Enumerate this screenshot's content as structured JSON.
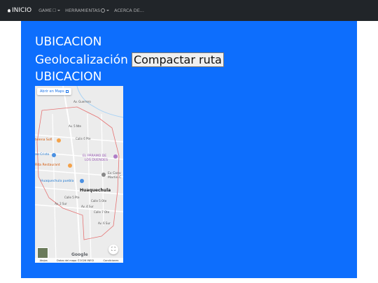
{
  "nav": {
    "brand": "INICIO",
    "items": [
      {
        "label": "GAME"
      },
      {
        "label": "HERRAMIENTAS"
      },
      {
        "label": "ACERCA DE..."
      }
    ]
  },
  "content": {
    "heading1": "UBICACION",
    "geo_label": "Geolocalización",
    "compact_button": "Compactar ruta",
    "heading2": "UBICACION"
  },
  "map": {
    "open_link": "Abrir en Maps",
    "labels": {
      "hotel_sofi": "telena Sofi",
      "christ": "ao Cristo",
      "rita": "Rita Restaurant",
      "paramo1": "EL PÁRAMO DE",
      "paramo2": "LOS DUENDES",
      "comercio1": "Ex Conv",
      "comercio2": "Martín C",
      "huaquechula_puebla": "Huaquechula puebla",
      "town": "Huaquechula",
      "calle6": "Calle 6 Pte",
      "calle5": "Calle 5 Pte",
      "calle5o": "Calle 5 Ote",
      "calle7": "Calle 7 Ote",
      "av4": "Av. 4 Sur",
      "av6": "Av. 6 Sur",
      "av2": "Av. 2 Sur",
      "av5": "Av. 5 Nte",
      "guerrero": "Av. Guerrero"
    },
    "google": "Google",
    "footer": {
      "shortcuts": "Atajos",
      "data": "Datos del mapa ©2026 INEGI",
      "terms": "Condiciones"
    }
  },
  "colors": {
    "navbar": "#212529",
    "container": "#0d6efd",
    "map_bg": "#ececec",
    "boundary": "#e57373"
  }
}
